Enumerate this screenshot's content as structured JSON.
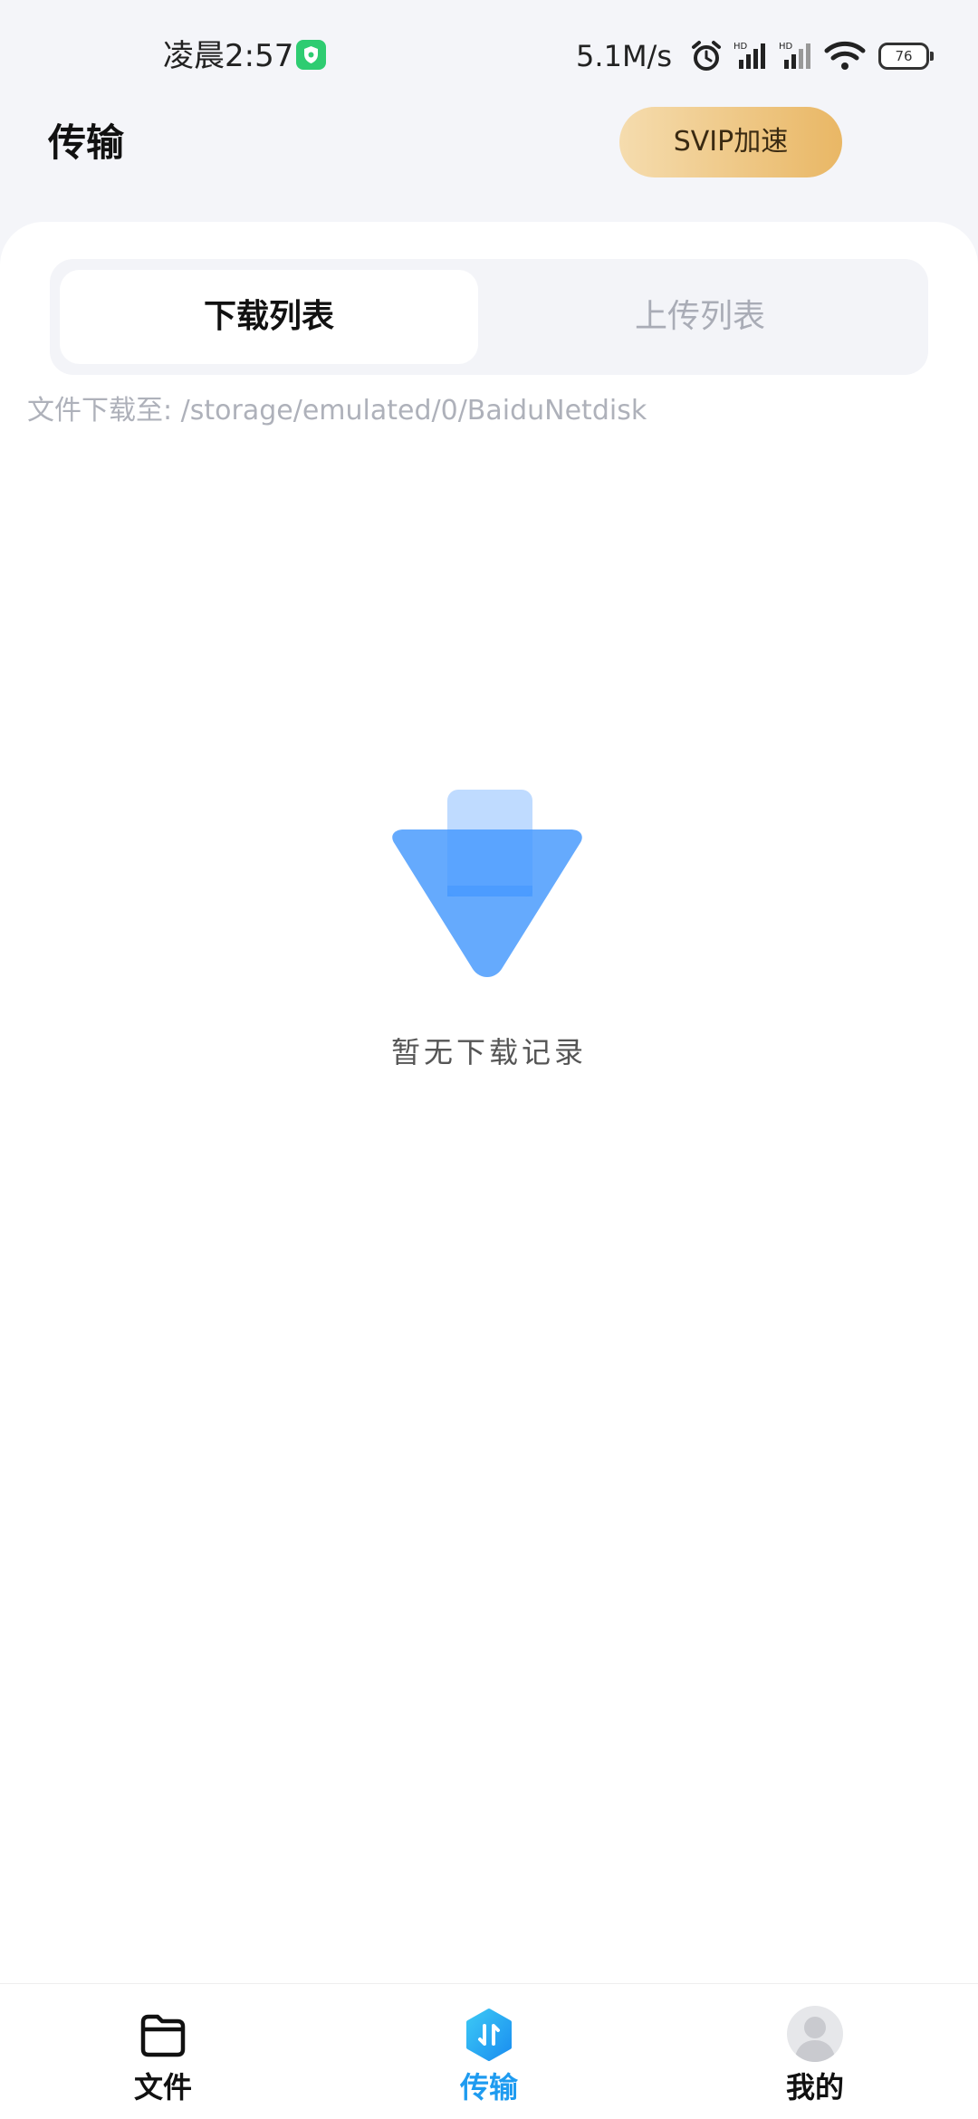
{
  "status_bar": {
    "time": "凌晨2:57",
    "net_speed": "5.1M/s",
    "battery": "76"
  },
  "header": {
    "title": "传输",
    "svip_label": "SVIP加速"
  },
  "tabs": {
    "download": "下载列表",
    "upload": "上传列表",
    "selected": "download"
  },
  "download_path": "文件下载至: /storage/emulated/0/BaiduNetdisk",
  "empty_state": {
    "message": "暂无下载记录"
  },
  "bottom_nav": {
    "items": [
      {
        "label": "文件",
        "icon": "folder-icon"
      },
      {
        "label": "传输",
        "icon": "transfer-icon",
        "active": true
      },
      {
        "label": "我的",
        "icon": "avatar"
      }
    ]
  },
  "colors": {
    "accent_blue": "#1e9bf0",
    "svip_gradient_start": "#f5dcae",
    "svip_gradient_end": "#e9b765",
    "illustration_blue": "#5fa6ff",
    "illustration_light": "#bcd9ff"
  }
}
